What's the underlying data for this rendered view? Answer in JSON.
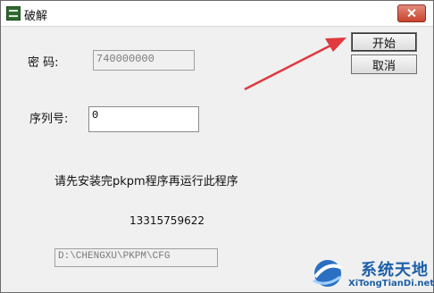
{
  "window": {
    "title": "破解"
  },
  "buttons": {
    "start": "开始",
    "cancel": "取消"
  },
  "fields": {
    "password_label": "密  码:",
    "password_value": "740000000",
    "serial_label": "序列号:",
    "serial_value": "0",
    "path_value": "D:\\CHENGXU\\PKPM\\CFG"
  },
  "message": "请先安装完pkpm程序再运行此程序",
  "number": "13315759622",
  "watermark": {
    "brand": "系统天地",
    "site": "XiTongTianDi.net",
    "logo_icon": "blue-swirl-logo"
  },
  "colors": {
    "arrow": "#e0393e",
    "watermark": "#1d5fa8",
    "close": "#c9432c"
  }
}
